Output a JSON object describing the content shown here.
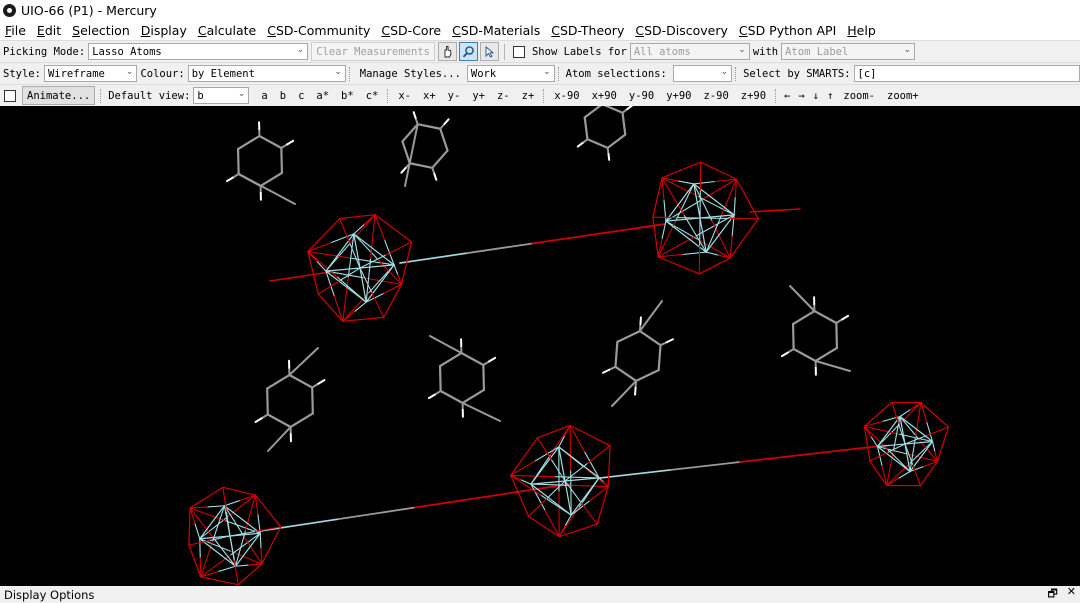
{
  "window": {
    "title": "UIO-66 (P1) - Mercury"
  },
  "menu": [
    "File",
    "Edit",
    "Selection",
    "Display",
    "Calculate",
    "CSD-Community",
    "CSD-Core",
    "CSD-Materials",
    "CSD-Theory",
    "CSD-Discovery",
    "CSD Python API",
    "Help"
  ],
  "toolbar1": {
    "picking_label": "Picking Mode:",
    "picking_value": "Lasso Atoms",
    "clear_measurements": "Clear Measurements",
    "show_labels": "Show Labels for",
    "labels_for_value": "All atoms",
    "with_label": "with",
    "with_value": "Atom Label"
  },
  "toolbar2": {
    "style_label": "Style:",
    "style_value": "Wireframe",
    "colour_label": "Colour:",
    "colour_value": "by Element",
    "manage_styles": "Manage Styles...",
    "work_value": "Work",
    "atom_selections": "Atom selections:",
    "atom_selections_value": "",
    "smarts_label": "Select by SMARTS:",
    "smarts_value": "[c]"
  },
  "toolbar3": {
    "animate": "Animate...",
    "default_view_label": "Default view:",
    "default_view_value": "b",
    "views": [
      "a",
      "b",
      "c",
      "a*",
      "b*",
      "c*"
    ],
    "rotations": [
      "x-",
      "x+",
      "y-",
      "y+",
      "z-",
      "z+",
      "x-90",
      "x+90",
      "y-90",
      "y+90",
      "z-90",
      "z+90"
    ],
    "arrows": [
      "←",
      "→",
      "↓",
      "↑"
    ],
    "zooms": [
      "zoom-",
      "zoom+"
    ]
  },
  "panel": {
    "title": "Display Options",
    "restore_icon": "🗗",
    "close_icon": "✕"
  },
  "colors": {
    "zr": "#9fdfe3",
    "oxygen": "#d40000",
    "carbon": "#9a9a9a",
    "hydrogen": "#ffffff",
    "background": "#000000"
  }
}
